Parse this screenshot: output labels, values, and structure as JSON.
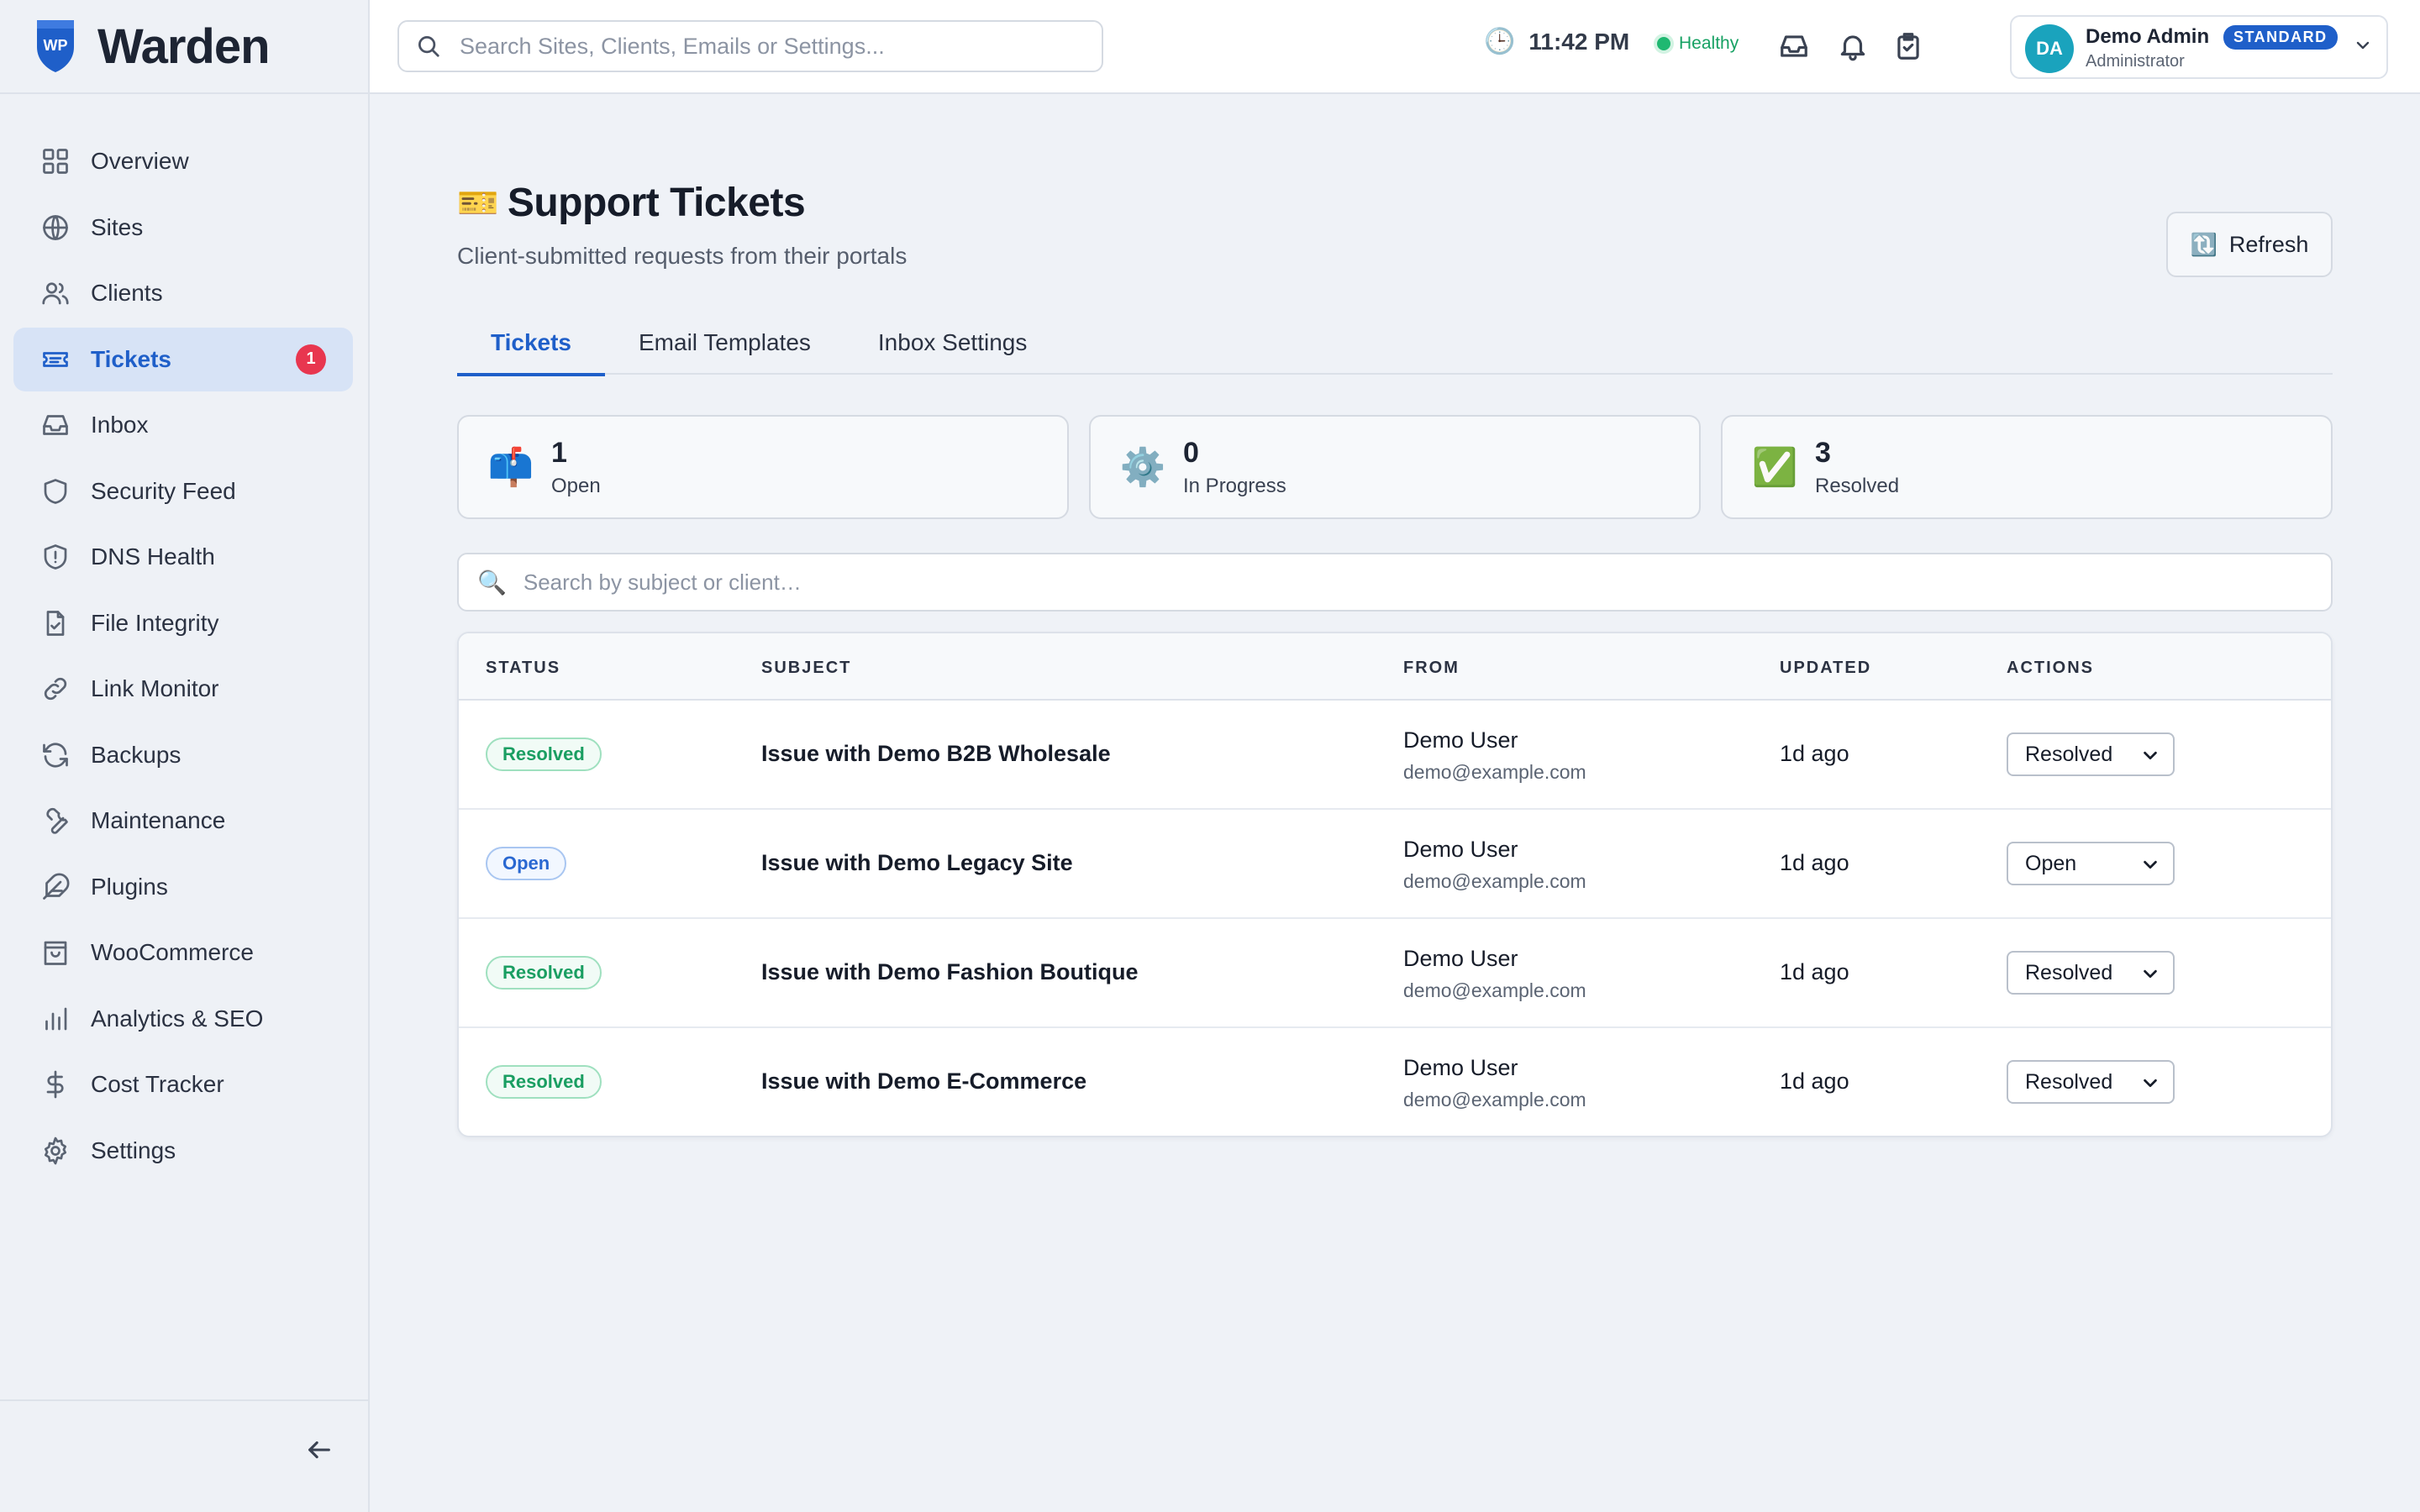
{
  "app": {
    "name": "Warden",
    "logo_text": "WP"
  },
  "sidebar": {
    "items": [
      {
        "key": "overview",
        "label": "Overview",
        "icon": "grid-icon"
      },
      {
        "key": "sites",
        "label": "Sites",
        "icon": "globe-icon"
      },
      {
        "key": "clients",
        "label": "Clients",
        "icon": "users-icon"
      },
      {
        "key": "tickets",
        "label": "Tickets",
        "icon": "ticket-icon",
        "active": true,
        "badge": "1"
      },
      {
        "key": "inbox",
        "label": "Inbox",
        "icon": "inbox-icon"
      },
      {
        "key": "security-feed",
        "label": "Security Feed",
        "icon": "shield-icon"
      },
      {
        "key": "dns-health",
        "label": "DNS Health",
        "icon": "shield-alert-icon"
      },
      {
        "key": "file-integrity",
        "label": "File Integrity",
        "icon": "file-check-icon"
      },
      {
        "key": "link-monitor",
        "label": "Link Monitor",
        "icon": "link-icon"
      },
      {
        "key": "backups",
        "label": "Backups",
        "icon": "refresh-icon"
      },
      {
        "key": "maintenance",
        "label": "Maintenance",
        "icon": "wrench-icon"
      },
      {
        "key": "plugins",
        "label": "Plugins",
        "icon": "feather-icon"
      },
      {
        "key": "woocommerce",
        "label": "WooCommerce",
        "icon": "shopping-bag-icon"
      },
      {
        "key": "analytics-seo",
        "label": "Analytics & SEO",
        "icon": "bar-chart-icon"
      },
      {
        "key": "cost-tracker",
        "label": "Cost Tracker",
        "icon": "dollar-icon"
      },
      {
        "key": "settings",
        "label": "Settings",
        "icon": "gear-icon"
      }
    ]
  },
  "topbar": {
    "search_placeholder": "Search Sites, Clients, Emails or Settings...",
    "clock_icon": "🕒",
    "time": "11:42 PM",
    "health": "Healthy",
    "theme_icon": "🌙",
    "user": {
      "initials": "DA",
      "name": "Demo Admin",
      "plan": "STANDARD",
      "role": "Administrator"
    }
  },
  "page": {
    "title_emoji": "🎫",
    "title": "Support Tickets",
    "subtitle": "Client-submitted requests from their portals",
    "refresh_icon": "🔃",
    "refresh_label": "Refresh",
    "tabs": [
      {
        "label": "Tickets",
        "active": true
      },
      {
        "label": "Email Templates"
      },
      {
        "label": "Inbox Settings"
      }
    ],
    "stats": [
      {
        "emoji": "📫",
        "value": "1",
        "label": "Open"
      },
      {
        "emoji": "⚙️",
        "value": "0",
        "label": "In Progress"
      },
      {
        "emoji": "✅",
        "value": "3",
        "label": "Resolved"
      }
    ],
    "search_icon": "🔍",
    "search_placeholder": "Search by subject or client…"
  },
  "table": {
    "columns": [
      "STATUS",
      "SUBJECT",
      "FROM",
      "UPDATED",
      "ACTIONS"
    ],
    "rows": [
      {
        "status": "Resolved",
        "status_kind": "resolved",
        "subject": "Issue with Demo B2B Wholesale",
        "from_name": "Demo User",
        "from_email": "demo@example.com",
        "updated": "1d ago",
        "action": "Resolved"
      },
      {
        "status": "Open",
        "status_kind": "open",
        "subject": "Issue with Demo Legacy Site",
        "from_name": "Demo User",
        "from_email": "demo@example.com",
        "updated": "1d ago",
        "action": "Open"
      },
      {
        "status": "Resolved",
        "status_kind": "resolved",
        "subject": "Issue with Demo Fashion Boutique",
        "from_name": "Demo User",
        "from_email": "demo@example.com",
        "updated": "1d ago",
        "action": "Resolved"
      },
      {
        "status": "Resolved",
        "status_kind": "resolved",
        "subject": "Issue with Demo E-Commerce",
        "from_name": "Demo User",
        "from_email": "demo@example.com",
        "updated": "1d ago",
        "action": "Resolved"
      }
    ]
  },
  "colors": {
    "accent": "#1f5fc9",
    "danger": "#e8364f",
    "success": "#1a9e62",
    "avatar": "#1aa3bd"
  }
}
